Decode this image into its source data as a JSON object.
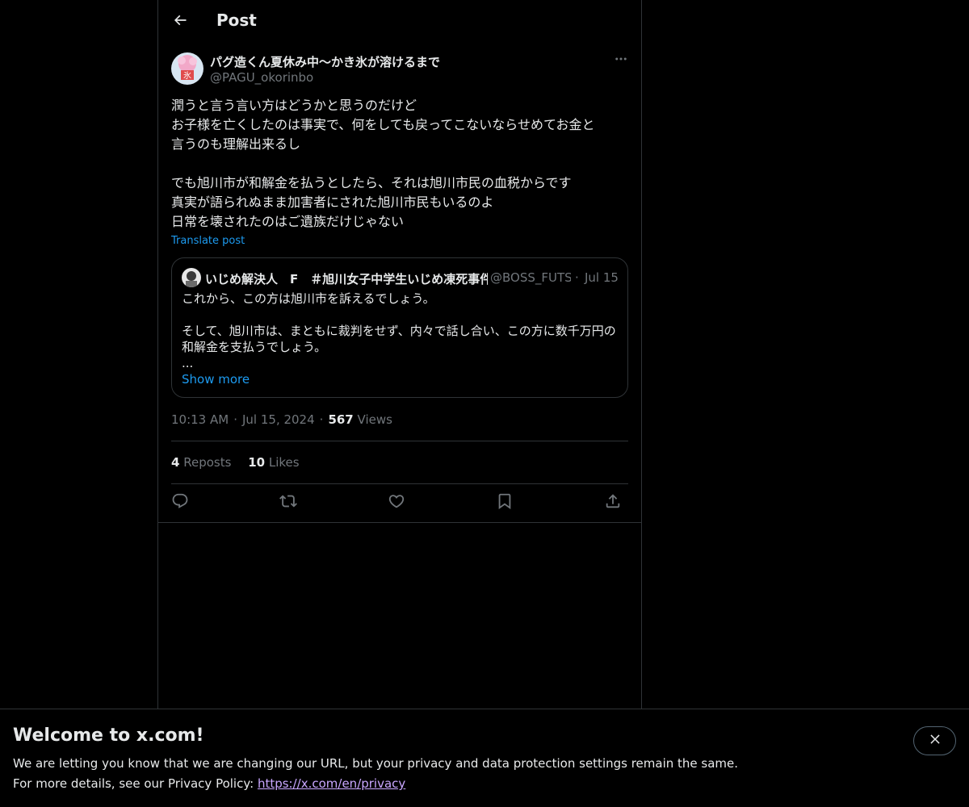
{
  "header": {
    "title": "Post"
  },
  "post": {
    "author": {
      "display_name": "パグ造くん夏休み中〜かき氷が溶けるまで",
      "handle": "@PAGU_okorinbo"
    },
    "body_lines": [
      "潤うと言う言い方はどうかと思うのだけど",
      "お子様を亡くしたのは事実で、何をしても戻ってこないならせめてお金と",
      "言うのも理解出来るし",
      "",
      "でも旭川市が和解金を払うとしたら、それは旭川市民の血税からです",
      "真実が語られぬまま加害者にされた旭川市民もいるのよ",
      "日常を壊されたのはご遺族だけじゃない"
    ],
    "translate_label": "Translate post",
    "quote": {
      "display_name": "いじめ解決人　F　＃旭川女子中学生いじめ凍死事件",
      "handle": "@BOSS_FUTSUI",
      "separator": "·",
      "date": "Jul 15",
      "body_lines": [
        "これから、この方は旭川市を訴えるでしょう。",
        "",
        "そして、旭川市は、まともに裁判をせず、内々で話し合い、この方に数千万円の",
        "和解金を支払うでしょう。",
        "..."
      ],
      "show_more_label": "Show more"
    },
    "meta": {
      "time": "10:13 AM",
      "separator": "·",
      "date": "Jul 15, 2024",
      "views_count": "567",
      "views_label": "Views"
    },
    "stats": {
      "reposts_count": "4",
      "reposts_label": "Reposts",
      "likes_count": "10",
      "likes_label": "Likes"
    }
  },
  "banner": {
    "title": "Welcome to x.com!",
    "line1": "We are letting you know that we are changing our URL, but your privacy and data protection settings remain the same.",
    "line2_prefix": "For more details, see our Privacy Policy: ",
    "link_text": "https://x.com/en/privacy"
  },
  "colors": {
    "background": "#000000",
    "text": "#e7e9ea",
    "muted": "#71767b",
    "accent": "#1d9bf0",
    "border": "#2f3336",
    "link_visited": "#c9a7ff"
  },
  "icons": {
    "back": "arrow-left-icon",
    "more": "more-horizontal-icon",
    "reply": "reply-icon",
    "repost": "repost-icon",
    "like": "heart-icon",
    "bookmark": "bookmark-icon",
    "share": "share-icon",
    "close": "close-icon"
  }
}
